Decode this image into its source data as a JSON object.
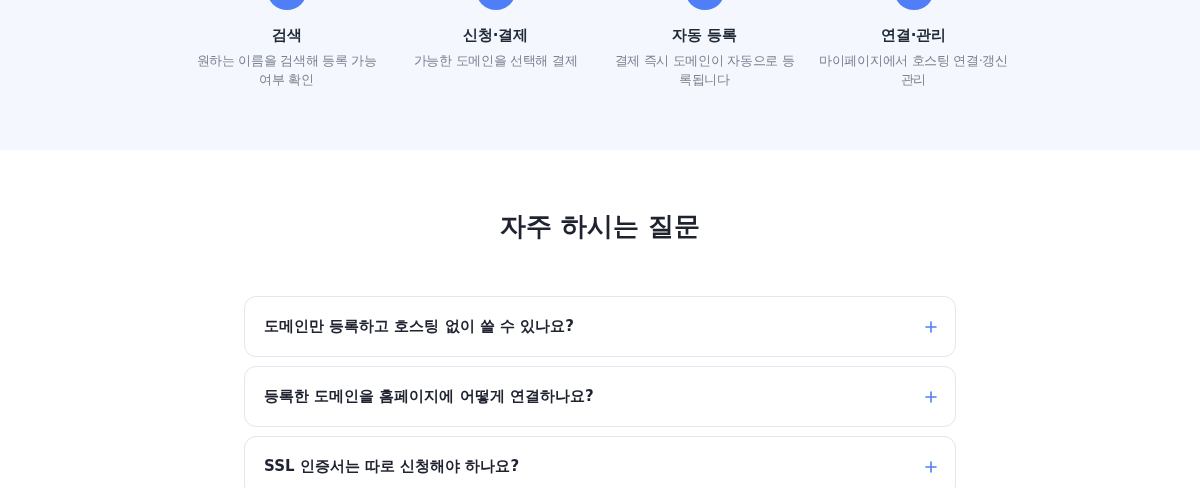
{
  "steps": [
    {
      "title": "검색",
      "description": "원하는 이름을 검색해 등록 가능 여부 확인"
    },
    {
      "title": "신청·결제",
      "description": "가능한 도메인을 선택해 결제"
    },
    {
      "title": "자동 등록",
      "description": "결제 즉시 도메인이 자동으로 등록됩니다"
    },
    {
      "title": "연결·관리",
      "description": "마이페이지에서 호스팅 연결·갱신 관리"
    }
  ],
  "faq": {
    "title": "자주 하시는 질문",
    "items": [
      {
        "question": "도메인만 등록하고 호스팅 없이 쓸 수 있나요?",
        "expanded": false
      },
      {
        "question": "등록한 도메인을 홈페이지에 어떻게 연결하나요?",
        "expanded": false
      },
      {
        "question": "SSL 인증서는 따로 신청해야 하나요?",
        "expanded": false
      }
    ]
  }
}
